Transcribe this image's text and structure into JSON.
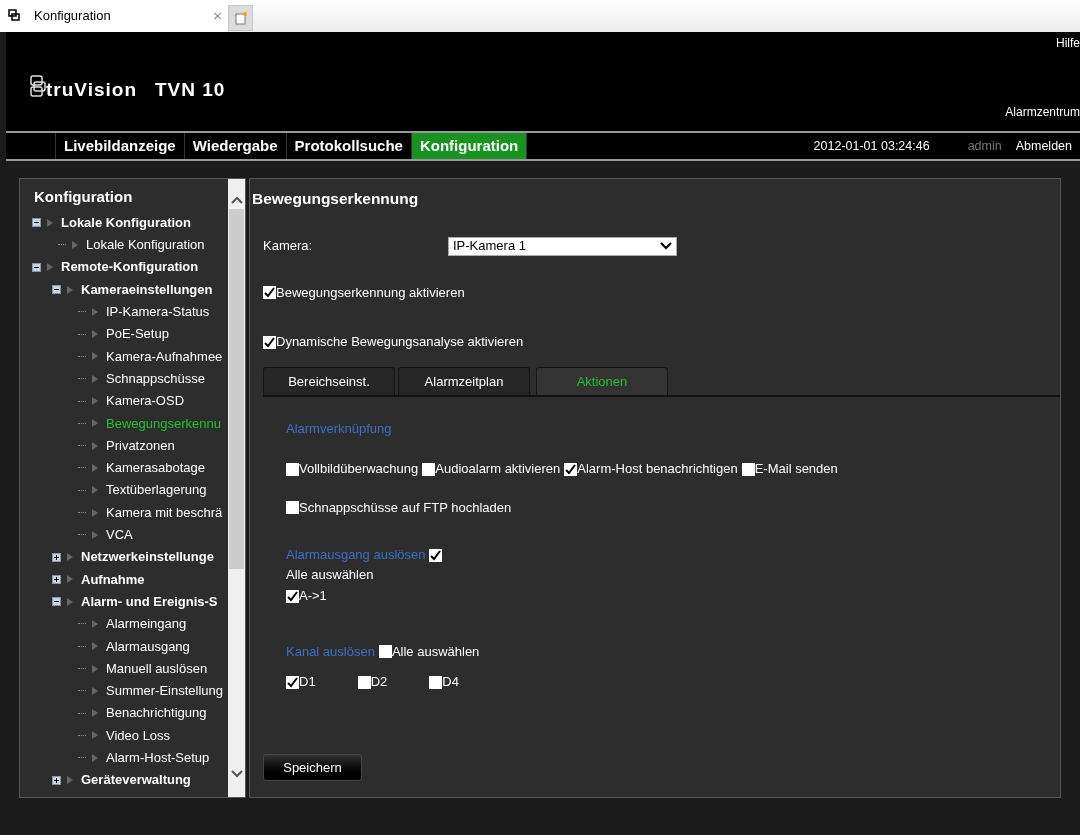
{
  "browser_tab": {
    "title": "Konfiguration",
    "close": "×"
  },
  "header": {
    "brand": "truVision",
    "model": "TVN 10",
    "help": "Hilfe",
    "alarm_center": "Alarmzentrum"
  },
  "nav": {
    "items": [
      {
        "label": "Livebildanzeige",
        "selected": false
      },
      {
        "label": "Wiedergabe",
        "selected": false
      },
      {
        "label": "Protokollsuche",
        "selected": false
      },
      {
        "label": "Konfiguration",
        "selected": true
      }
    ],
    "datetime": "2012-01-01 03:24:46",
    "user": "admin",
    "logout": "Abmelden"
  },
  "sidebar": {
    "title": "Konfiguration",
    "tree": [
      {
        "label": "Lokale Konfiguration",
        "expanded": true,
        "selected": false,
        "children": [
          {
            "label": "Lokale Konfiguration",
            "selected": false
          }
        ]
      },
      {
        "label": "Remote-Konfiguration",
        "expanded": true,
        "selected": false,
        "children": [
          {
            "label": "Kameraeinstellungen",
            "expanded": true,
            "selected": false,
            "children": [
              {
                "label": "IP-Kamera-Status",
                "selected": false
              },
              {
                "label": "PoE-Setup",
                "selected": false
              },
              {
                "label": "Kamera-Aufnahmee",
                "selected": false
              },
              {
                "label": "Schnappschüsse",
                "selected": false
              },
              {
                "label": "Kamera-OSD",
                "selected": false
              },
              {
                "label": "Bewegungserkennu",
                "selected": true
              },
              {
                "label": "Privatzonen",
                "selected": false
              },
              {
                "label": "Kamerasabotage",
                "selected": false
              },
              {
                "label": "Textüberlagerung",
                "selected": false
              },
              {
                "label": "Kamera mit beschrä",
                "selected": false
              },
              {
                "label": "VCA",
                "selected": false
              }
            ]
          },
          {
            "label": "Netzwerkeinstellunge",
            "expanded": false,
            "selected": false
          },
          {
            "label": "Aufnahme",
            "expanded": false,
            "selected": false
          },
          {
            "label": "Alarm- und Ereignis-S",
            "expanded": true,
            "selected": false,
            "children": [
              {
                "label": "Alarmeingang",
                "selected": false
              },
              {
                "label": "Alarmausgang",
                "selected": false
              },
              {
                "label": "Manuell auslösen",
                "selected": false
              },
              {
                "label": "Summer-Einstellung",
                "selected": false
              },
              {
                "label": "Benachrichtigung",
                "selected": false
              },
              {
                "label": "Video Loss",
                "selected": false
              },
              {
                "label": "Alarm-Host-Setup",
                "selected": false
              }
            ]
          },
          {
            "label": "Geräteverwaltung",
            "expanded": false,
            "selected": false
          }
        ]
      }
    ]
  },
  "main": {
    "title": "Bewegungserkennung",
    "camera": {
      "label": "Kamera:",
      "value": "IP-Kamera 1"
    },
    "options": [
      {
        "label": "Bewegungserkennung aktivieren",
        "checked": true
      },
      {
        "label": "Dynamische Bewegungsanalyse aktivieren",
        "checked": true
      }
    ],
    "tabs": [
      {
        "label": "Bereichseinst.",
        "selected": false
      },
      {
        "label": "Alarmzeitplan",
        "selected": false
      },
      {
        "label": "Aktionen",
        "selected": true
      }
    ],
    "linkage": {
      "title": "Alarmverknüpfung",
      "rows": [
        [
          {
            "label": "Vollbildüberwachung",
            "checked": false
          },
          {
            "label": "Audioalarm aktivieren",
            "checked": false
          },
          {
            "label": "Alarm-Host benachrichtigen",
            "checked": true
          },
          {
            "label": "E-Mail senden",
            "checked": false
          }
        ],
        [
          {
            "label": "Schnappschüsse auf FTP hochladen",
            "checked": false
          }
        ]
      ]
    },
    "alarm_output": {
      "title": "Alarmausgang auslösen",
      "checked": true,
      "select_all": "Alle auswählen",
      "items": [
        {
          "label": "A->1",
          "checked": true
        }
      ]
    },
    "channels": {
      "title": "Kanal auslösen",
      "select_all": {
        "label": "Alle auswählen",
        "checked": false
      },
      "items": [
        {
          "label": "D1",
          "checked": true
        },
        {
          "label": "D2",
          "checked": false
        },
        {
          "label": "D4",
          "checked": false
        }
      ]
    },
    "save": "Speichern"
  }
}
